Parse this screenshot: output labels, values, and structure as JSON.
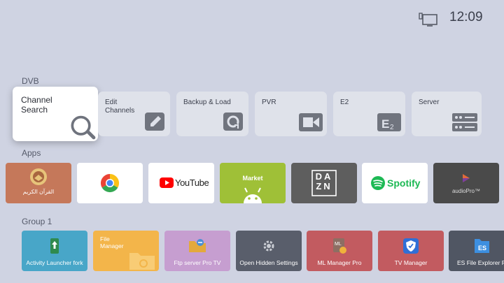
{
  "status": {
    "clock": "12:09",
    "icon": "tv-input-icon"
  },
  "sections": {
    "dvb": "DVB",
    "apps": "Apps",
    "group1": "Group 1"
  },
  "dvb": [
    {
      "label": "Channel\nSearch",
      "icon": "search-icon",
      "focused": true
    },
    {
      "label": "Edit\nChannels",
      "icon": "edit-icon"
    },
    {
      "label": "Backup & Load",
      "icon": "restore-icon"
    },
    {
      "label": "PVR",
      "icon": "video-camera-icon"
    },
    {
      "label": "E2",
      "icon": "e2-icon"
    },
    {
      "label": "Server",
      "icon": "server-icon"
    }
  ],
  "apps": [
    {
      "name": "القرآن الكريم",
      "icon": "quran-icon",
      "bg": "#c5785a"
    },
    {
      "name": "",
      "icon": "chrome-icon",
      "bg": "#ffffff"
    },
    {
      "name": "YouTube",
      "icon": "youtube-icon",
      "bg": "#ffffff"
    },
    {
      "name": "Market",
      "icon": "android-icon",
      "bg": "#9fc037"
    },
    {
      "name": "DAZN",
      "icon": "dazn-icon",
      "bg": "#5e5e5e"
    },
    {
      "name": "Spotify",
      "icon": "spotify-icon",
      "bg": "#ffffff"
    },
    {
      "name": "audioPro™",
      "icon": "audiopro-icon",
      "bg": "#4a4a4a"
    }
  ],
  "group1": [
    {
      "name": "Activity Launcher fork",
      "icon": "activity-launcher-icon",
      "bg": "#48a6c8"
    },
    {
      "name": "File Manager",
      "icon": "folder-icon",
      "bg": "#f3b54a"
    },
    {
      "name": "Ftp server Pro TV",
      "icon": "ftp-icon",
      "bg": "#c69ed0"
    },
    {
      "name": "Open Hidden Settings",
      "icon": "gear-icon",
      "bg": "#595e6b"
    },
    {
      "name": "ML Manager Pro",
      "icon": "ml-manager-icon",
      "bg": "#c25b60"
    },
    {
      "name": "TV Manager",
      "icon": "shield-icon",
      "bg": "#c25b60"
    },
    {
      "name": "ES File Explorer Pro",
      "icon": "es-explorer-icon",
      "bg": "#505663"
    }
  ]
}
